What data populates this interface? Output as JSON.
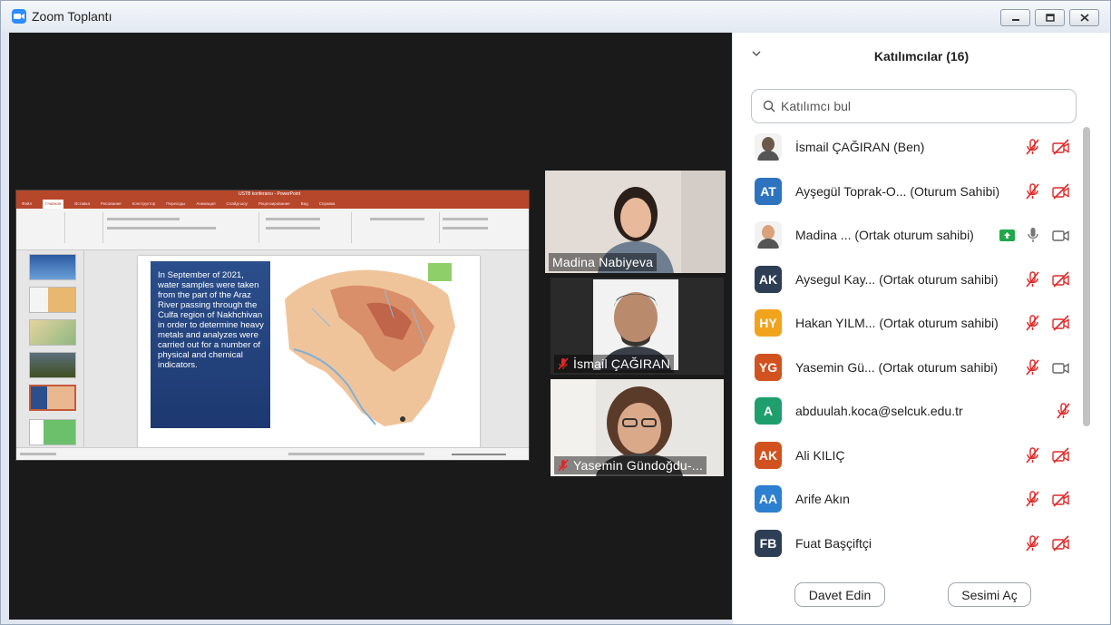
{
  "window": {
    "title": "Zoom Toplantı"
  },
  "share": {
    "ppt_title": "USTB konferansı - PowerPoint",
    "ppt_tabs": [
      "Файл",
      "Главная",
      "Вставка",
      "Рисование",
      "Конструктор",
      "Переходы",
      "Анимация",
      "Слайд-шоу",
      "Рецензирование",
      "Вид",
      "Справка"
    ],
    "slide_text": "In September of 2021, water samples were taken from the part of the Araz River passing through the Culfa region of Nakhchivan in order to determine heavy metals and analyzes were carried out for a number of physical and chemical indicators."
  },
  "videos": [
    {
      "name": "Madina Nabiyeva",
      "muted": false
    },
    {
      "name": "İsmail ÇAĞIRAN",
      "muted": true
    },
    {
      "name": "Yasemin Gündoğdu-...",
      "muted": true
    }
  ],
  "panel": {
    "title": "Katılımcılar (16)",
    "search_placeholder": "Katılımcı bul",
    "invite_label": "Davet Edin",
    "unmute_label": "Sesimi Aç"
  },
  "participants": [
    {
      "initials": "",
      "photo": true,
      "color": "#6b5a4a",
      "name": "İsmail ÇAĞIRAN (Ben)",
      "mic": "muted",
      "video": "off",
      "share": false
    },
    {
      "initials": "AT",
      "photo": false,
      "color": "#2d73c0",
      "name": "Ayşegül Toprak-O...  (Oturum Sahibi)",
      "mic": "muted",
      "video": "off",
      "share": false
    },
    {
      "initials": "",
      "photo": true,
      "color": "#d9a27a",
      "name": "Madina ...  (Ortak oturum sahibi)",
      "mic": "on",
      "video": "on",
      "share": true
    },
    {
      "initials": "AK",
      "photo": false,
      "color": "#2e3e55",
      "name": "Aysegul Kay...  (Ortak oturum sahibi)",
      "mic": "muted",
      "video": "off",
      "share": false
    },
    {
      "initials": "HY",
      "photo": false,
      "color": "#f2a31c",
      "name": "Hakan YILM...  (Ortak oturum sahibi)",
      "mic": "muted",
      "video": "off",
      "share": false
    },
    {
      "initials": "YG",
      "photo": false,
      "color": "#d2521f",
      "name": "Yasemin Gü...  (Ortak oturum sahibi)",
      "mic": "muted",
      "video": "on",
      "share": false
    },
    {
      "initials": "A",
      "photo": false,
      "color": "#1f9e6e",
      "name": "abduulah.koca@selcuk.edu.tr",
      "mic": "muted",
      "video": "none",
      "share": false
    },
    {
      "initials": "AK",
      "photo": false,
      "color": "#d2521f",
      "name": "Ali KILIÇ",
      "mic": "muted",
      "video": "off",
      "share": false
    },
    {
      "initials": "AA",
      "photo": false,
      "color": "#2d7fd0",
      "name": "Arife Akın",
      "mic": "muted",
      "video": "off",
      "share": false
    },
    {
      "initials": "FB",
      "photo": false,
      "color": "#2e3e55",
      "name": "Fuat Başçiftçi",
      "mic": "muted",
      "video": "off",
      "share": false
    }
  ]
}
